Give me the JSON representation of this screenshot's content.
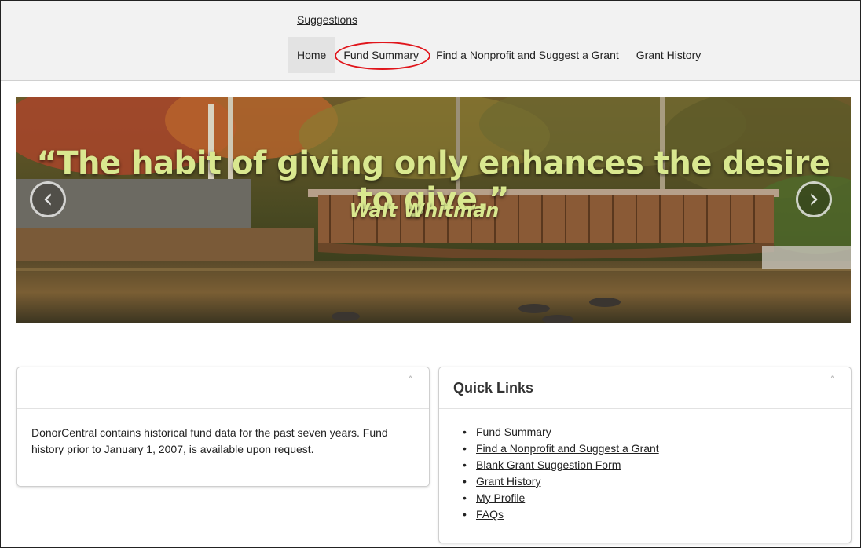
{
  "header": {
    "suggestions_link": "Suggestions",
    "nav": [
      {
        "label": "Home"
      },
      {
        "label": "Fund Summary"
      },
      {
        "label": "Find a Nonprofit and Suggest a Grant"
      },
      {
        "label": "Grant History"
      }
    ]
  },
  "carousel": {
    "quote": "“The habit of giving only enhances the desire to give.”",
    "author": "Walt Whitman",
    "prev_symbol": "‹",
    "next_symbol": "›"
  },
  "info_panel": {
    "title": "",
    "text": "DonorCentral contains historical fund data for the past seven years. Fund history prior to January 1, 2007, is available upon request.",
    "collapse_symbol": "˄"
  },
  "quick_links": {
    "title": "Quick Links",
    "collapse_symbol": "˄",
    "bullet": "•",
    "items": [
      {
        "label": "Fund Summary"
      },
      {
        "label": "Find a Nonprofit and Suggest a Grant"
      },
      {
        "label": "Blank Grant Suggestion Form"
      },
      {
        "label": "Grant History"
      },
      {
        "label": "My Profile"
      },
      {
        "label": "FAQs"
      }
    ]
  },
  "colors": {
    "header_bg": "#f2f2f2",
    "highlight_ring": "#e0151b",
    "quote_text": "#d9e88f"
  }
}
